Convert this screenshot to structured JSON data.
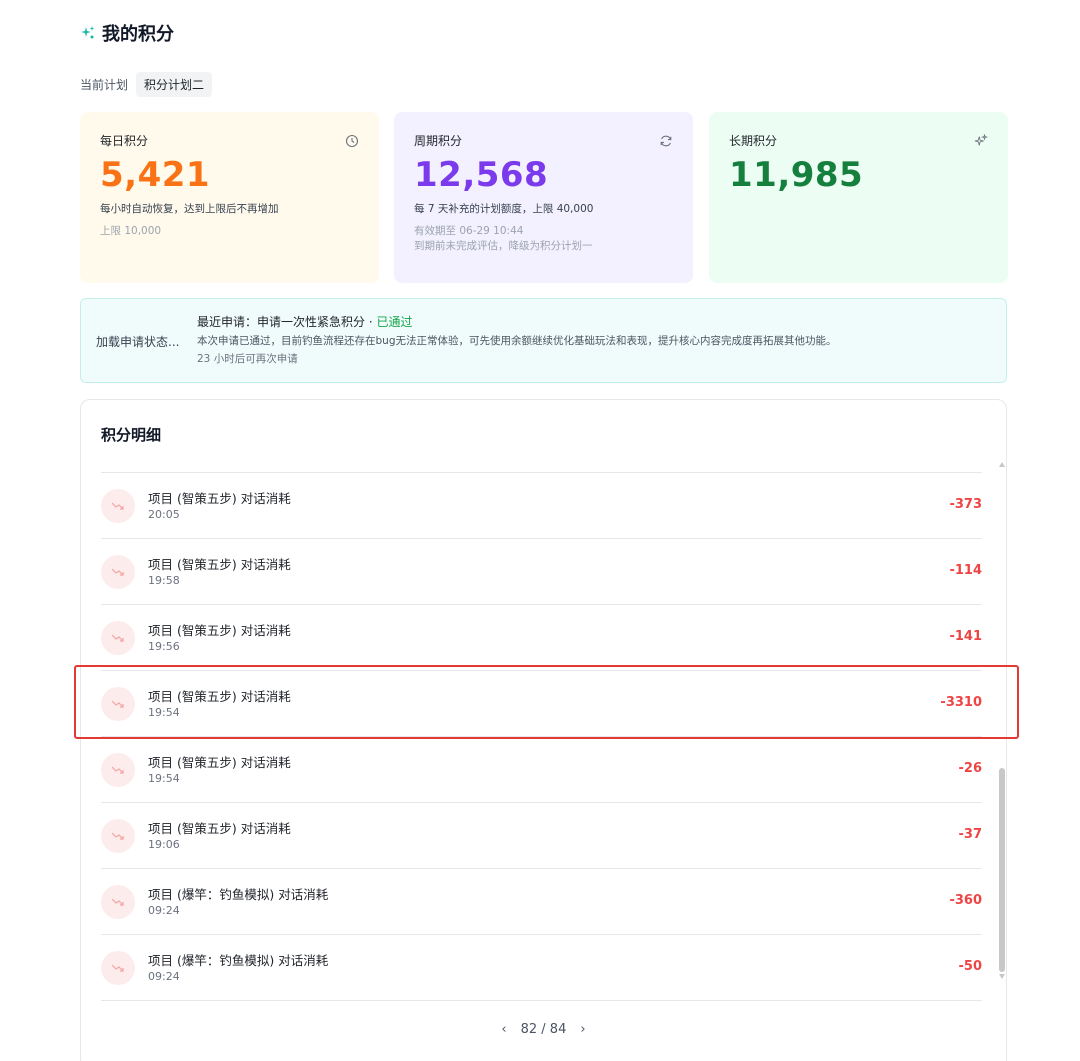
{
  "header": {
    "title": "我的积分",
    "icon": "sparkle-icon"
  },
  "plan": {
    "label": "当前计划",
    "value": "积分计划二"
  },
  "cards": {
    "daily": {
      "title": "每日积分",
      "icon": "clock-icon",
      "value": "5,421",
      "desc": "每小时自动恢复，达到上限后不再增加",
      "sub1": "上限 10,000"
    },
    "period": {
      "title": "周期积分",
      "icon": "refresh-icon",
      "value": "12,568",
      "desc": "每 7 天补充的计划额度，上限 40,000",
      "sub1": "有效期至 06-29 10:44",
      "sub2": "到期前未完成评估，降级为积分计划一"
    },
    "long": {
      "title": "长期积分",
      "icon": "sparkle-icon",
      "value": "11,985"
    }
  },
  "status": {
    "label": "加载申请状态...",
    "line1_prefix": "最近申请：申请一次性紧急积分 · ",
    "line1_status": "已通过",
    "line2": "本次申请已通过，目前钓鱼流程还存在bug无法正常体验，可先使用余额继续优化基础玩法和表现，提升核心内容完成度再拓展其他功能。",
    "line3": "23 小时后可再次申请"
  },
  "ledger": {
    "title": "积分明细",
    "items": [
      {
        "title": "项目 (智策五步) 对话消耗",
        "time": "20:05",
        "amount": "-373"
      },
      {
        "title": "项目 (智策五步) 对话消耗",
        "time": "19:58",
        "amount": "-114"
      },
      {
        "title": "项目 (智策五步) 对话消耗",
        "time": "19:56",
        "amount": "-141"
      },
      {
        "title": "项目 (智策五步) 对话消耗",
        "time": "19:54",
        "amount": "-3310"
      },
      {
        "title": "项目 (智策五步) 对话消耗",
        "time": "19:54",
        "amount": "-26"
      },
      {
        "title": "项目 (智策五步) 对话消耗",
        "time": "19:06",
        "amount": "-37"
      },
      {
        "title": "项目 (爆竿：钓鱼模拟) 对话消耗",
        "time": "09:24",
        "amount": "-360"
      },
      {
        "title": "项目 (爆竿：钓鱼模拟) 对话消耗",
        "time": "09:24",
        "amount": "-50"
      }
    ]
  },
  "pager": {
    "prev": "‹",
    "text": "82 / 84",
    "next": "›"
  },
  "colors": {
    "negative": "#ef4444",
    "daily": "#f97316",
    "period": "#7c3aed",
    "long": "#15803d",
    "highlight": "#e53935"
  }
}
